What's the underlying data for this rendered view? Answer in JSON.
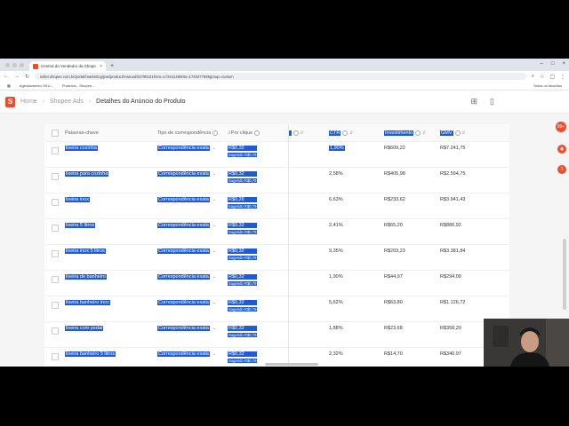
{
  "browser": {
    "tab_title": "Central do Vendedor da Shope",
    "new_tab": "+",
    "url": "seller.shopee.com.br/portal/marketing/pas/product/manual/32795101from=1724412800to=1730277599group=custom",
    "bookmarks": [
      "Agendamento OKU...",
      "Produtos - Shopee..."
    ],
    "all_bookmarks": "Todos os favoritos"
  },
  "header": {
    "crumbs": [
      "Home",
      "Shopee Ads",
      "Detalhes do Anúncio do Produto"
    ]
  },
  "table": {
    "columns": {
      "keyword": "Palavras-chave",
      "match": "Tipo de correspondência",
      "bid": "Por clique",
      "ctr": "CTR",
      "invest": "Investimento",
      "gmv": "GMV"
    },
    "rows": [
      {
        "keyword": "lixeira cozinha",
        "match": "Correspondência exata",
        "bid": "R$0,32",
        "sug": "Sugerido R$0,79",
        "ctr": "1,90%",
        "invest": "R$609,22",
        "gmv": "R$7.241,75"
      },
      {
        "keyword": "lixeira para cozinha",
        "match": "Correspondência exata",
        "bid": "R$0,32",
        "sug": "Sugerido R$0,79",
        "ctr": "2,58%",
        "invest": "R$405,98",
        "gmv": "R$2.594,75"
      },
      {
        "keyword": "lixeira inox",
        "match": "Correspondência exata",
        "bid": "R$0,26",
        "sug": "Sugerido R$0,79",
        "ctr": "6,63%",
        "invest": "R$233,62",
        "gmv": "R$3.941,43"
      },
      {
        "keyword": "lixeira 5 litros",
        "match": "Correspondência exata",
        "bid": "R$0,32",
        "sug": "Sugerido R$0,79",
        "ctr": "2,41%",
        "invest": "R$65,20",
        "gmv": "R$886,92"
      },
      {
        "keyword": "lixeira inox 5 litros",
        "match": "Correspondência exata",
        "bid": "R$0,32",
        "sug": "Sugerido R$0,79",
        "ctr": "9,35%",
        "invest": "R$203,23",
        "gmv": "R$3.381,84"
      },
      {
        "keyword": "lixeira de banheiro",
        "match": "Correspondência exata",
        "bid": "R$0,32",
        "sug": "Sugerido R$0,79",
        "ctr": "1,90%",
        "invest": "R$44,97",
        "gmv": "R$294,00"
      },
      {
        "keyword": "lixeira banheiro inox",
        "match": "Correspondência exata",
        "bid": "R$0,32",
        "sug": "Sugerido R$0,79",
        "ctr": "5,62%",
        "invest": "R$63,80",
        "gmv": "R$1.126,72"
      },
      {
        "keyword": "lixeira com pedal",
        "match": "Correspondência exata",
        "bid": "R$0,32",
        "sug": "Sugerido R$0,79",
        "ctr": "1,88%",
        "invest": "R$23,68",
        "gmv": "R$358,29"
      },
      {
        "keyword": "lixeira banheiro 5 litros",
        "match": "Correspondência exata",
        "bid": "R$0,32",
        "sug": "Sugerido R$0,79",
        "ctr": "2,32%",
        "invest": "R$14,70",
        "gmv": "R$340,97"
      }
    ]
  },
  "side_badges": [
    "99+",
    "1"
  ],
  "colors": {
    "brand": "#ee4d2d",
    "selection": "#1f5bd6"
  }
}
